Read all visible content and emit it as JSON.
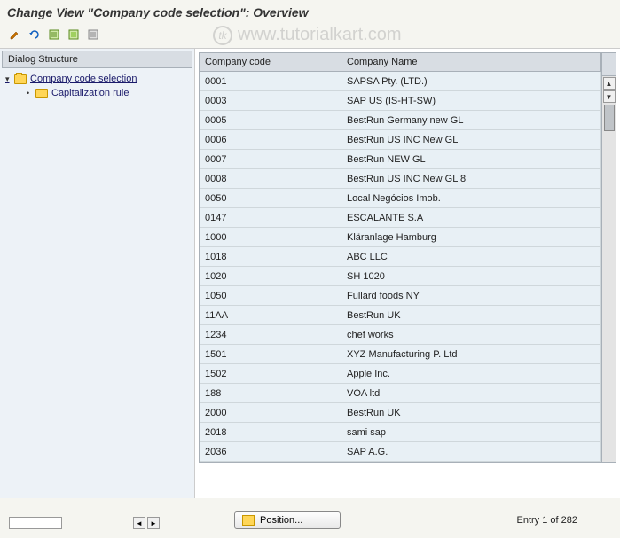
{
  "title": "Change View \"Company code selection\": Overview",
  "watermark": "www.tutorialkart.com",
  "toolbar": {
    "icons": [
      "pencil-icon",
      "glasses-icon",
      "save-icon",
      "save-icon-2",
      "table-icon"
    ]
  },
  "left_pane": {
    "header": "Dialog Structure",
    "tree": [
      {
        "label": "Company code selection",
        "level": 1,
        "open": true
      },
      {
        "label": "Capitalization rule",
        "level": 2,
        "open": false
      }
    ]
  },
  "table": {
    "headers": {
      "code": "Company code",
      "name": "Company Name"
    },
    "rows": [
      {
        "code": "0001",
        "name": "SAPSA Pty. (LTD.)"
      },
      {
        "code": "0003",
        "name": "SAP US (IS-HT-SW)"
      },
      {
        "code": "0005",
        "name": "BestRun Germany new GL"
      },
      {
        "code": "0006",
        "name": "BestRun US INC New GL"
      },
      {
        "code": "0007",
        "name": "BestRun NEW GL"
      },
      {
        "code": "0008",
        "name": "BestRun US INC New GL 8"
      },
      {
        "code": "0050",
        "name": "Local Negócios Imob."
      },
      {
        "code": "0147",
        "name": "ESCALANTE S.A"
      },
      {
        "code": "1000",
        "name": "Kläranlage Hamburg"
      },
      {
        "code": "1018",
        "name": "ABC LLC"
      },
      {
        "code": "1020",
        "name": "SH 1020"
      },
      {
        "code": "1050",
        "name": "Fullard foods NY"
      },
      {
        "code": "11AA",
        "name": "BestRun UK"
      },
      {
        "code": "1234",
        "name": "chef works"
      },
      {
        "code": "1501",
        "name": "XYZ Manufacturing P. Ltd"
      },
      {
        "code": "1502",
        "name": "Apple Inc."
      },
      {
        "code": "188",
        "name": "VOA ltd"
      },
      {
        "code": "2000",
        "name": "BestRun UK"
      },
      {
        "code": "2018",
        "name": "sami sap"
      },
      {
        "code": "2036",
        "name": "SAP A.G."
      }
    ]
  },
  "footer": {
    "position_label": "Position...",
    "entry_text": "Entry 1 of 282"
  }
}
